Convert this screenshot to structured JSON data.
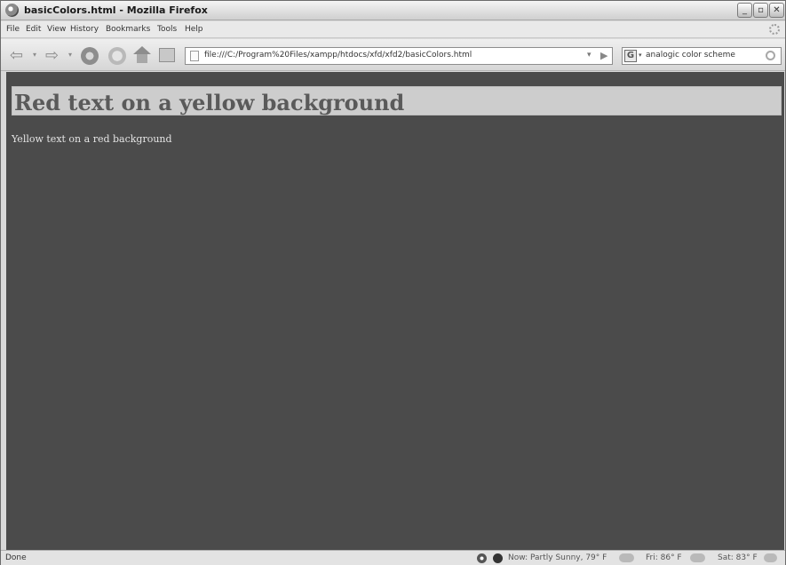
{
  "window": {
    "title": "basicColors.html - Mozilla Firefox",
    "controls": {
      "minimize": "_",
      "maximize": "▫",
      "close": "✕"
    }
  },
  "menu": [
    "File",
    "Edit",
    "View",
    "History",
    "Bookmarks",
    "Tools",
    "Help"
  ],
  "nav": {
    "url": "file:///C:/Program%20Files/xampp/htdocs/xfd/xfd2/basicColors.html",
    "search": {
      "engine": "G",
      "query": "analogic color scheme"
    }
  },
  "page": {
    "heading": "Red text on a yellow background",
    "paragraph": "Yellow text on a red background"
  },
  "status": {
    "text": "Done",
    "weather_now": "Now: Partly Sunny, 79° F",
    "weather_fri": "Fri: 86° F",
    "weather_sat": "Sat: 83° F"
  }
}
